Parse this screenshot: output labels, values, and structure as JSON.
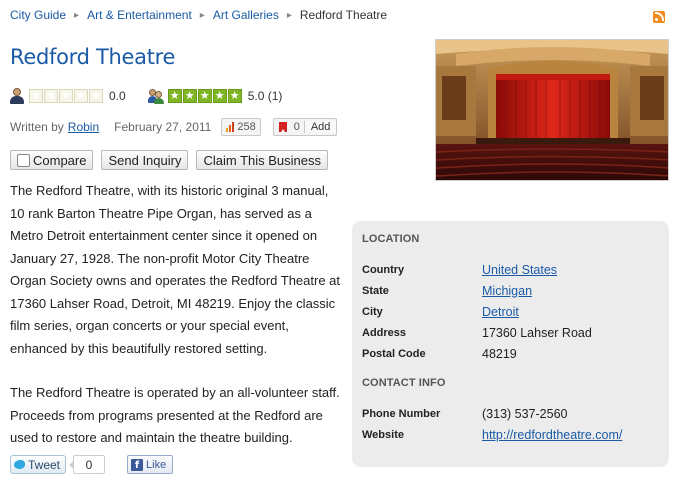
{
  "breadcrumb": {
    "items": [
      "City Guide",
      "Art & Entertainment",
      "Art Galleries"
    ],
    "current": "Redford Theatre"
  },
  "rss_icon": "rss-feed-icon",
  "title": "Redford Theatre",
  "ratings": {
    "editor": {
      "icon": "user-icon",
      "stars": 0,
      "value": "0.0"
    },
    "users": {
      "icon": "group-icon",
      "stars": 5,
      "value": "5.0 (1)"
    }
  },
  "meta": {
    "written_by_label": "Written by",
    "author": "Robin",
    "date": "February 27, 2011",
    "views": "258",
    "bookmarks": "0",
    "add_label": "Add"
  },
  "actions": {
    "compare_label": "Compare",
    "send_inquiry_label": "Send Inquiry",
    "claim_label": "Claim This Business"
  },
  "description": {
    "paragraph1": "The Redford Theatre, with its historic original 3 manual, 10 rank Barton Theatre Pipe Organ, has served as a Metro Detroit entertainment center since it opened on January 27, 1928. The non-profit Motor City Theatre Organ Society owns and operates the Redford Theatre at 17360 Lahser Road, Detroit, MI 48219. Enjoy the classic film series, organ concerts or your special event, enhanced by this beautifully restored setting.",
    "paragraph2": "The Redford Theatre is operated by an all-volunteer staff. Proceeds from programs presented at the Redford are used to restore and maintain the theatre building."
  },
  "location": {
    "heading": "LOCATION",
    "rows": [
      {
        "label": "Country",
        "value": "United States"
      },
      {
        "label": "State",
        "value": "Michigan"
      },
      {
        "label": "City",
        "value": "Detroit"
      },
      {
        "label": "Address",
        "value": "17360 Lahser Road"
      },
      {
        "label": "Postal Code",
        "value": "48219"
      }
    ]
  },
  "contact": {
    "heading": "CONTACT INFO",
    "rows": [
      {
        "label": "Phone Number",
        "value": "(313) 537-2560"
      },
      {
        "label": "Website",
        "value": "http://redfordtheatre.com/"
      }
    ]
  },
  "social": {
    "tweet_label": "Tweet",
    "tweet_count": "0",
    "like_label": "Like"
  },
  "colors": {
    "link": "#1a5aa6",
    "star_full": "#7fb522",
    "panel_bg": "#ececec"
  }
}
